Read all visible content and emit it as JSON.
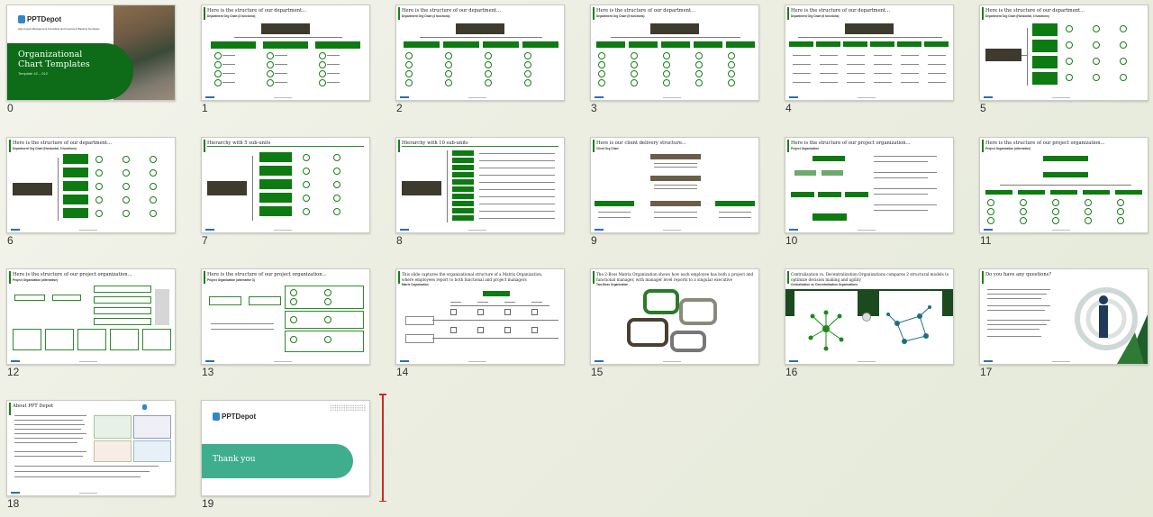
{
  "slides": [
    {
      "number": "0",
      "title": "",
      "subtitle": ""
    },
    {
      "number": "1",
      "title": "Here is the structure of our department...",
      "subtitle": "Department Org Chart (3 functions)"
    },
    {
      "number": "2",
      "title": "Here is the structure of our department...",
      "subtitle": "Department Org Chart (4 functions)"
    },
    {
      "number": "3",
      "title": "Here is the structure of our department...",
      "subtitle": "Department Org Chart (5 functions)"
    },
    {
      "number": "4",
      "title": "Here is the structure of our department...",
      "subtitle": "Department Org Chart (6 functions)"
    },
    {
      "number": "5",
      "title": "Here is the structure of our department...",
      "subtitle": "Department Org Chart (Horizontal, 4 functions)"
    },
    {
      "number": "6",
      "title": "Here is the structure of our department...",
      "subtitle": "Department Org Chart (Horizontal, 5 functions)"
    },
    {
      "number": "7",
      "title": "Hierarchy with 5 sub-units",
      "subtitle": ""
    },
    {
      "number": "8",
      "title": "Hierarchy with 10 sub-units",
      "subtitle": ""
    },
    {
      "number": "9",
      "title": "Here is our client delivery structure...",
      "subtitle": "Client Org Chart"
    },
    {
      "number": "10",
      "title": "Here is the structure of our project organization...",
      "subtitle": "Project Organization"
    },
    {
      "number": "11",
      "title": "Here is the structure of our project organization...",
      "subtitle": "Project Organization (alternative)"
    },
    {
      "number": "12",
      "title": "Here is the structure of our project organization...",
      "subtitle": "Project Organization (alternative)"
    },
    {
      "number": "13",
      "title": "Here is the structure of our project organization...",
      "subtitle": "Project Organization (alternative 3)"
    },
    {
      "number": "14",
      "title": "This slide captures the organizational structure of a Matrix Organization, where employees report to both functional and project managers",
      "subtitle": "Matrix Organization"
    },
    {
      "number": "15",
      "title": "The 2-Boss Matrix Organization shows how each employee has both a project and functional manager, with manager level reports to a singular executive",
      "subtitle": "Two-Boss Organization"
    },
    {
      "number": "16",
      "title": "Centralization vs. Decentralization Organizations compares 2 structural models to optimize decision making and agility",
      "subtitle": "Centralization vs. Decentralization Organizations"
    },
    {
      "number": "17",
      "title": "Do you have any questions?",
      "subtitle": ""
    },
    {
      "number": "18",
      "title": "About PPT Depot",
      "subtitle": ""
    },
    {
      "number": "19",
      "title": "",
      "subtitle": ""
    }
  ],
  "cover": {
    "brand": "PPTDepot",
    "tagline": "High-Impact Management Consulting and Investment Banking Templates",
    "heading_line1": "Organizational",
    "heading_line2": "Chart Templates",
    "template": "Template 42 – 012"
  },
  "closing": {
    "brand": "PPTDepot",
    "text": "Thank you"
  },
  "colors": {
    "accent_green": "#0d7a12",
    "dark_box": "#3e3a2e",
    "teal": "#3fae8e",
    "selection": "#d42626"
  }
}
